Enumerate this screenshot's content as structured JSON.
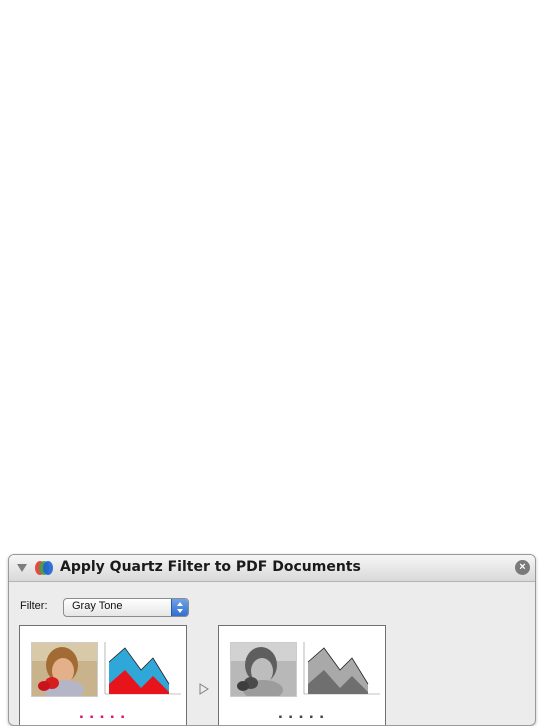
{
  "action": {
    "title": "Apply Quartz Filter to PDF Documents",
    "icon": "quartz-filter-icon",
    "filter_label": "Filter:",
    "filter_value": "Gray Tone",
    "disclosure_icon": "disclosure-triangle-down-icon",
    "close_icon": "close-circle-icon",
    "preview_arrow_icon": "arrow-right-icon"
  },
  "colors": {
    "panel_bg": "#ececec",
    "select_accent": "#3a7ce0",
    "chart_blue": "#2fa7d8",
    "chart_red": "#e8141c",
    "chart_gray_light": "#a9a9a9",
    "chart_gray_dark": "#6f6f6f"
  }
}
